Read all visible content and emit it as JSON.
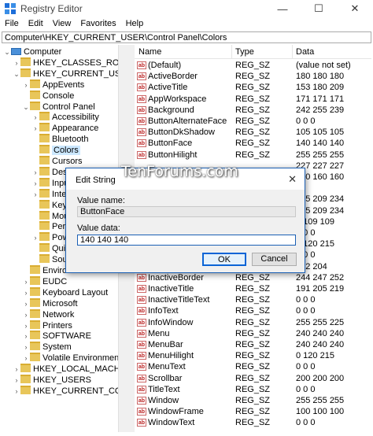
{
  "window": {
    "title": "Registry Editor",
    "minimize": "—",
    "maximize": "☐",
    "close": "✕"
  },
  "menu": [
    "File",
    "Edit",
    "View",
    "Favorites",
    "Help"
  ],
  "address": "Computer\\HKEY_CURRENT_USER\\Control Panel\\Colors",
  "tree": [
    {
      "label": "Computer",
      "arrow": "v",
      "kind": "pc",
      "indent": 0
    },
    {
      "label": "HKEY_CLASSES_ROOT",
      "arrow": ">",
      "kind": "folder",
      "indent": 1
    },
    {
      "label": "HKEY_CURRENT_USER",
      "arrow": "v",
      "kind": "folder",
      "indent": 1
    },
    {
      "label": "AppEvents",
      "arrow": ">",
      "kind": "folder",
      "indent": 2
    },
    {
      "label": "Console",
      "arrow": "",
      "kind": "folder",
      "indent": 2
    },
    {
      "label": "Control Panel",
      "arrow": "v",
      "kind": "folder",
      "indent": 2
    },
    {
      "label": "Accessibility",
      "arrow": ">",
      "kind": "folder",
      "indent": 3
    },
    {
      "label": "Appearance",
      "arrow": ">",
      "kind": "folder",
      "indent": 3
    },
    {
      "label": "Bluetooth",
      "arrow": "",
      "kind": "folder",
      "indent": 3
    },
    {
      "label": "Colors",
      "arrow": "",
      "kind": "folder",
      "indent": 3,
      "selected": true
    },
    {
      "label": "Cursors",
      "arrow": "",
      "kind": "folder",
      "indent": 3
    },
    {
      "label": "Deskt",
      "arrow": ">",
      "kind": "folder",
      "indent": 3
    },
    {
      "label": "Input",
      "arrow": ">",
      "kind": "folder",
      "indent": 3
    },
    {
      "label": "Inter",
      "arrow": ">",
      "kind": "folder",
      "indent": 3
    },
    {
      "label": "Keyb",
      "arrow": "",
      "kind": "folder",
      "indent": 3
    },
    {
      "label": "Mous",
      "arrow": "",
      "kind": "folder",
      "indent": 3
    },
    {
      "label": "Perso",
      "arrow": "",
      "kind": "folder",
      "indent": 3
    },
    {
      "label": "Powe",
      "arrow": ">",
      "kind": "folder",
      "indent": 3
    },
    {
      "label": "Quic",
      "arrow": "",
      "kind": "folder",
      "indent": 3
    },
    {
      "label": "Soun",
      "arrow": "",
      "kind": "folder",
      "indent": 3
    },
    {
      "label": "Environ",
      "arrow": "",
      "kind": "folder",
      "indent": 2
    },
    {
      "label": "EUDC",
      "arrow": ">",
      "kind": "folder",
      "indent": 2
    },
    {
      "label": "Keyboard Layout",
      "arrow": ">",
      "kind": "folder",
      "indent": 2
    },
    {
      "label": "Microsoft",
      "arrow": ">",
      "kind": "folder",
      "indent": 2
    },
    {
      "label": "Network",
      "arrow": ">",
      "kind": "folder",
      "indent": 2
    },
    {
      "label": "Printers",
      "arrow": ">",
      "kind": "folder",
      "indent": 2
    },
    {
      "label": "SOFTWARE",
      "arrow": ">",
      "kind": "folder",
      "indent": 2
    },
    {
      "label": "System",
      "arrow": ">",
      "kind": "folder",
      "indent": 2
    },
    {
      "label": "Volatile Environment",
      "arrow": ">",
      "kind": "folder",
      "indent": 2
    },
    {
      "label": "HKEY_LOCAL_MACHINE",
      "arrow": ">",
      "kind": "folder",
      "indent": 1
    },
    {
      "label": "HKEY_USERS",
      "arrow": ">",
      "kind": "folder",
      "indent": 1
    },
    {
      "label": "HKEY_CURRENT_CONFIG",
      "arrow": ">",
      "kind": "folder",
      "indent": 1
    }
  ],
  "list": {
    "headers": [
      "Name",
      "Type",
      "Data"
    ],
    "rows": [
      [
        "(Default)",
        "REG_SZ",
        "(value not set)"
      ],
      [
        "ActiveBorder",
        "REG_SZ",
        "180 180 180"
      ],
      [
        "ActiveTitle",
        "REG_SZ",
        "153 180 209"
      ],
      [
        "AppWorkspace",
        "REG_SZ",
        "171 171 171"
      ],
      [
        "Background",
        "REG_SZ",
        "242 255 239"
      ],
      [
        "ButtonAlternateFace",
        "REG_SZ",
        "0 0 0"
      ],
      [
        "ButtonDkShadow",
        "REG_SZ",
        "105 105 105"
      ],
      [
        "ButtonFace",
        "REG_SZ",
        "140 140 140"
      ],
      [
        "ButtonHilight",
        "REG_SZ",
        "255 255 255"
      ],
      [
        "",
        "",
        "227 227 227"
      ],
      [
        "",
        "",
        "160 160 160"
      ],
      [
        "",
        "",
        ""
      ],
      [
        "",
        "",
        "215 209 234"
      ],
      [
        "",
        "",
        "185 209 234"
      ],
      [
        "",
        "",
        "0 109 109"
      ],
      [
        "",
        "",
        "0 0 0"
      ],
      [
        "",
        "",
        "0 120 215"
      ],
      [
        "",
        "",
        "0 0 0"
      ],
      [
        "",
        "",
        "102 204"
      ],
      [
        "InactiveBorder",
        "REG_SZ",
        "244 247 252"
      ],
      [
        "InactiveTitle",
        "REG_SZ",
        "191 205 219"
      ],
      [
        "InactiveTitleText",
        "REG_SZ",
        "0 0 0"
      ],
      [
        "InfoText",
        "REG_SZ",
        "0 0 0"
      ],
      [
        "InfoWindow",
        "REG_SZ",
        "255 255 225"
      ],
      [
        "Menu",
        "REG_SZ",
        "240 240 240"
      ],
      [
        "MenuBar",
        "REG_SZ",
        "240 240 240"
      ],
      [
        "MenuHilight",
        "REG_SZ",
        "0 120 215"
      ],
      [
        "MenuText",
        "REG_SZ",
        "0 0 0"
      ],
      [
        "Scrollbar",
        "REG_SZ",
        "200 200 200"
      ],
      [
        "TitleText",
        "REG_SZ",
        "0 0 0"
      ],
      [
        "Window",
        "REG_SZ",
        "255 255 255"
      ],
      [
        "WindowFrame",
        "REG_SZ",
        "100 100 100"
      ],
      [
        "WindowText",
        "REG_SZ",
        "0 0 0"
      ]
    ],
    "icon_text": "ab"
  },
  "dialog": {
    "title": "Edit String",
    "close": "✕",
    "watermark": "TenForums.com",
    "value_name_label": "Value name:",
    "value_name": "ButtonFace",
    "value_data_label": "Value data:",
    "value_data": "140 140 140",
    "ok": "OK",
    "cancel": "Cancel"
  }
}
